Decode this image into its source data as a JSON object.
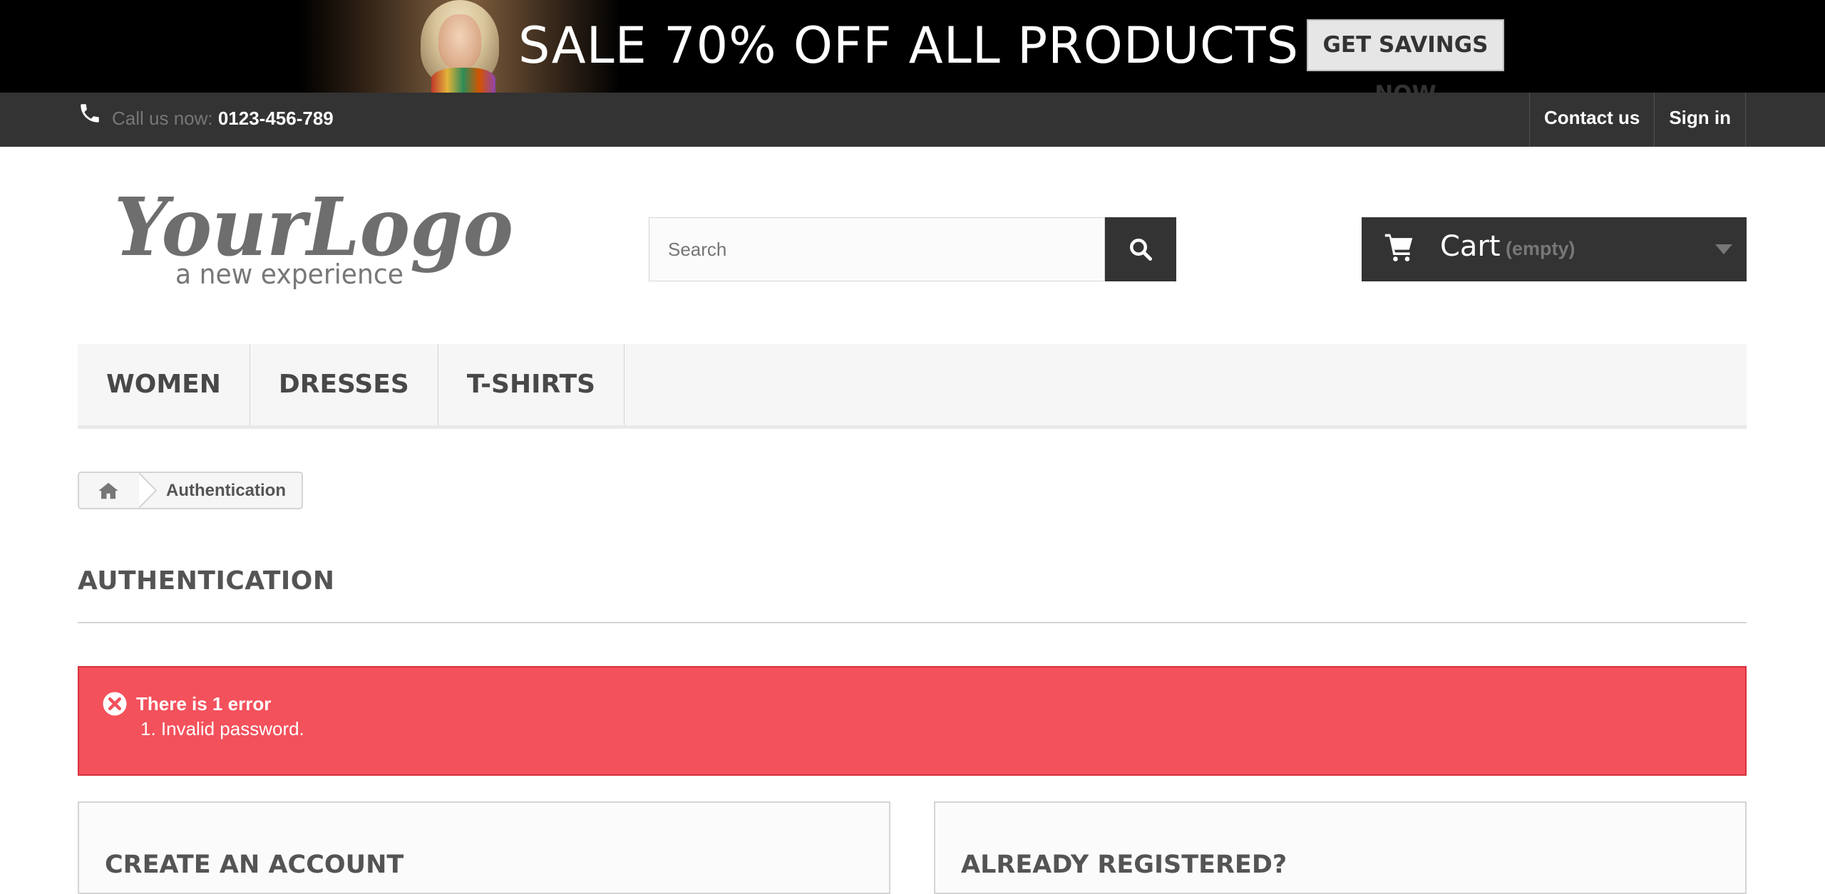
{
  "banner": {
    "headline": "SALE 70% OFF ALL PRODUCTS",
    "cta_label": "GET SAVINGS NOW"
  },
  "topbar": {
    "call_label": "Call us now: ",
    "phone": "0123-456-789",
    "links": [
      {
        "label": "Contact us"
      },
      {
        "label": "Sign in"
      }
    ]
  },
  "logo": {
    "title": "YourLogo",
    "tagline": "a new experience"
  },
  "search": {
    "placeholder": "Search",
    "value": ""
  },
  "cart": {
    "label": "Cart",
    "status": "(empty)"
  },
  "menu": {
    "items": [
      {
        "label": "WOMEN"
      },
      {
        "label": "DRESSES"
      },
      {
        "label": "T-SHIRTS"
      }
    ]
  },
  "breadcrumb": {
    "current": "Authentication"
  },
  "page": {
    "heading": "AUTHENTICATION"
  },
  "alert": {
    "title": "There is 1 error",
    "errors": [
      "1. Invalid password."
    ]
  },
  "boxes": {
    "create_title": "CREATE AN ACCOUNT",
    "registered_title": "ALREADY REGISTERED?"
  },
  "colors": {
    "topbar": "#333333",
    "alert": "#f3515c",
    "cart": "#333333",
    "menu_bg": "#f6f6f6"
  }
}
